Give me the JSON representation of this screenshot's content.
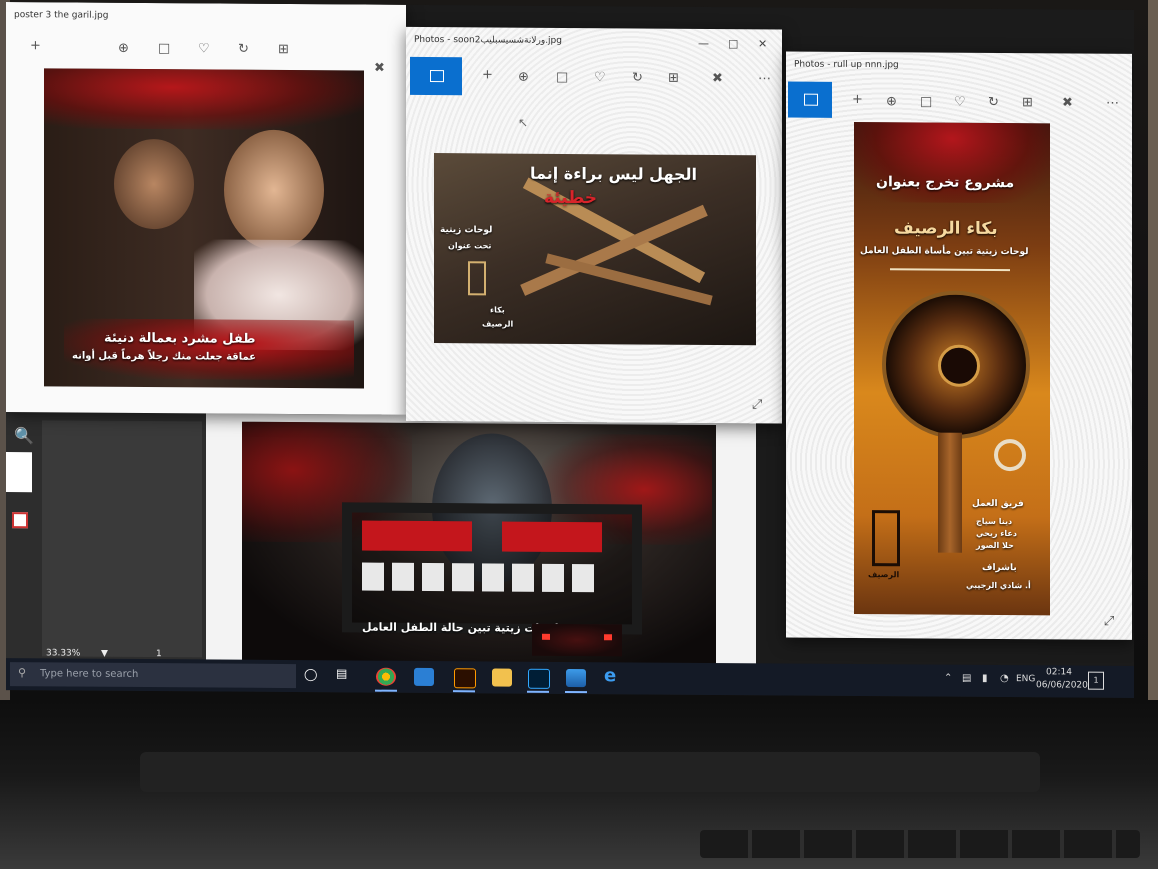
{
  "windows": {
    "left": {
      "title": "poster 3 the garil.jpg"
    },
    "middle": {
      "title": "Photos - soon2ورلانةشسيسبليب.jpg"
    },
    "right": {
      "title": "Photos - rull up nnn.jpg"
    }
  },
  "posters": {
    "child": {
      "line1": "طفل مشرد بعمالة دنيئة",
      "line2": "عماقة جعلت منك رجلاً هرماً قبل أوانه"
    },
    "ignorance": {
      "headline": "الجهل ليس براءة إنما",
      "red": "خطيئة",
      "sub1": "لوحات زيتية",
      "sub2": "تحت عنوان",
      "sub3": "بكاء",
      "sub4": "الرصيف"
    },
    "rollup": {
      "top": "مشروع تخرج بعنوان",
      "title": "بكاء الرصيف",
      "subtitle": "لوحات زيتية تبين مأساة الطفل العامل",
      "team_label": "فريق العمل",
      "member1": "دينا سياج",
      "member2": "دعاء ريحي",
      "member3": "حلا الصور",
      "supervision": "باشراف",
      "supervisor": "أ. شادي الرجيبي",
      "logo_text": "الرصيف"
    },
    "street": {
      "tagline": "لوحات زيتية تبين حالة الطفل العامل"
    }
  },
  "editor": {
    "zoom": "33.33%",
    "page": "1"
  },
  "taskbar": {
    "search_placeholder": "Type here to search",
    "lang": "ENG",
    "time": "02:14",
    "date": "06/06/2020",
    "notif_count": "1"
  },
  "colors": {
    "accent": "#0a6fcf",
    "poster_red": "#c4161c",
    "rollup_orange": "#d9881c"
  }
}
